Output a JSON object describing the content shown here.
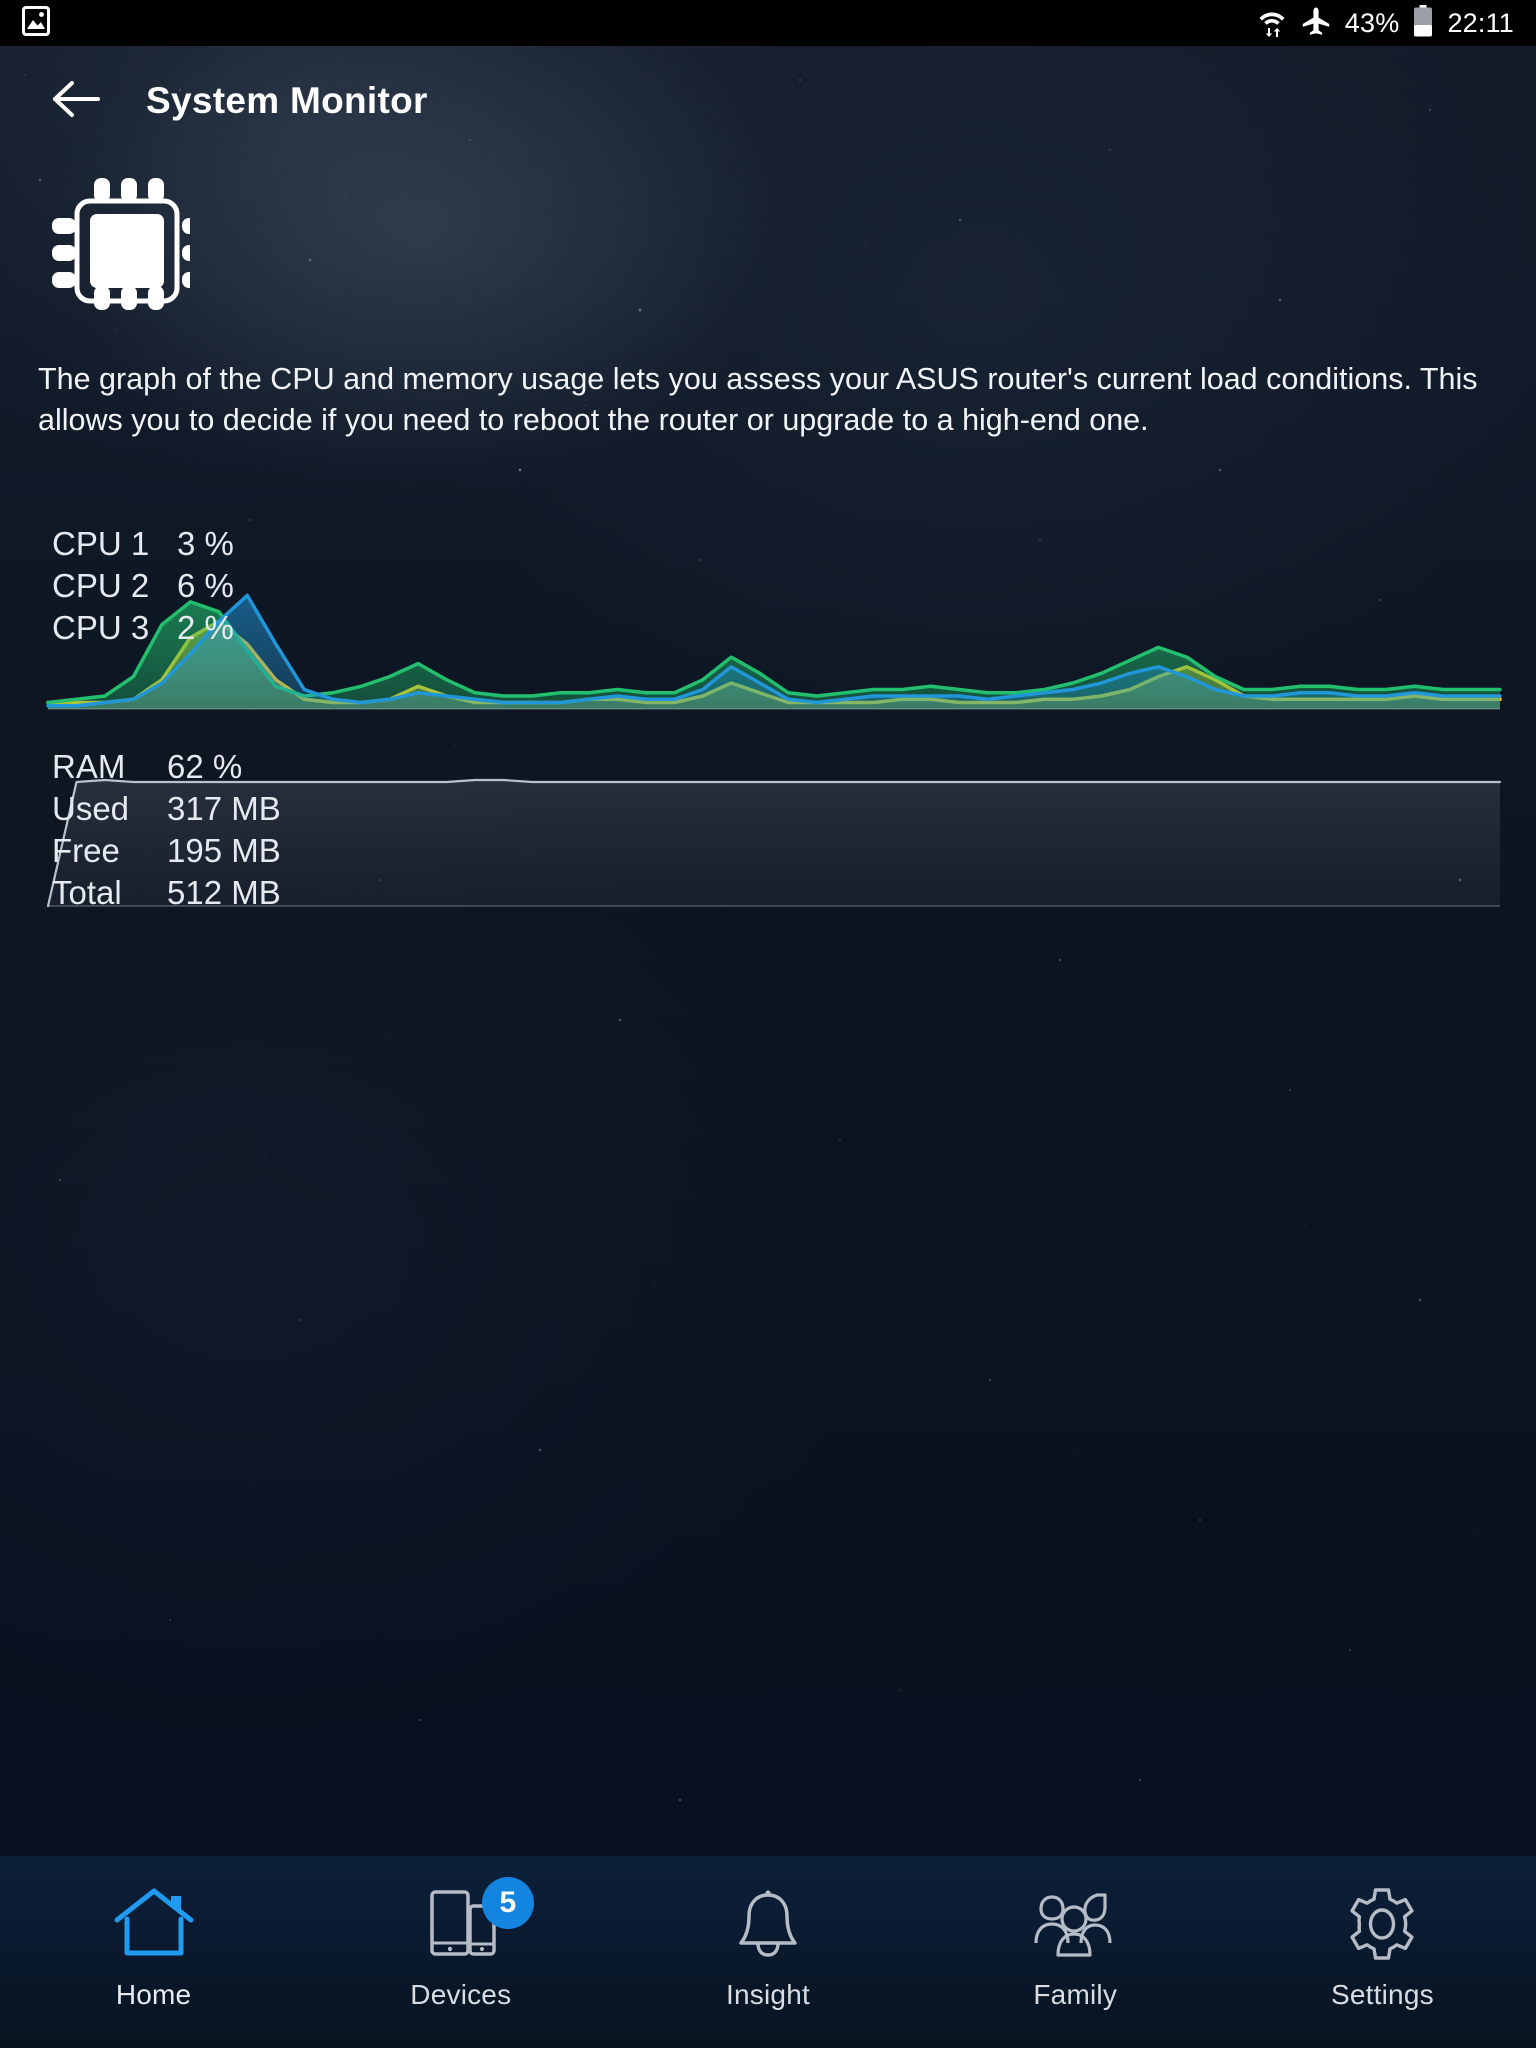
{
  "status_bar": {
    "left_icon": "image-icon",
    "wifi_icon": "wifi-transfer-icon",
    "airplane_icon": "airplane-mode-icon",
    "battery_percent": "43%",
    "battery_icon": "battery-icon",
    "time": "22:11"
  },
  "header": {
    "back_icon": "back-arrow-icon",
    "title": "System Monitor"
  },
  "main": {
    "hero_icon": "cpu-chip-icon",
    "description": "The graph of the CPU and memory usage lets you assess your ASUS router's current load conditions. This allows you to decide if you need to reboot the router or upgrade to a high-end one."
  },
  "cpu": {
    "rows": [
      {
        "label": "CPU 1",
        "value": "3 %",
        "color": "#f5c518"
      },
      {
        "label": "CPU 2",
        "value": "6 %",
        "color": "#22c06e"
      },
      {
        "label": "CPU 3",
        "value": "2 %",
        "color": "#2196d8"
      }
    ]
  },
  "ram": {
    "rows": [
      {
        "label": "RAM",
        "value": "62 %"
      },
      {
        "label": "Used",
        "value": "317 MB"
      },
      {
        "label": "Free",
        "value": "195 MB"
      },
      {
        "label": "Total",
        "value": "512 MB"
      }
    ]
  },
  "bottom_nav": {
    "items": [
      {
        "label": "Home",
        "icon": "home-icon",
        "active": true,
        "badge": null
      },
      {
        "label": "Devices",
        "icon": "devices-icon",
        "active": false,
        "badge": "5"
      },
      {
        "label": "Insight",
        "icon": "bell-icon",
        "active": false,
        "badge": null
      },
      {
        "label": "Family",
        "icon": "family-icon",
        "active": false,
        "badge": null
      },
      {
        "label": "Settings",
        "icon": "gear-icon",
        "active": false,
        "badge": null
      }
    ]
  },
  "colors": {
    "accent": "#1385e0",
    "cpu1": "#f5c518",
    "cpu2": "#22c06e",
    "cpu3": "#2196d8",
    "ram_line": "#b9c2cc",
    "background": "#0d1521",
    "text": "#ffffff"
  },
  "chart_data": [
    {
      "type": "area",
      "title": "CPU usage",
      "series": [
        {
          "name": "CPU 1",
          "color": "#f5c518",
          "values": [
            2,
            2,
            2,
            3,
            9,
            22,
            27,
            20,
            9,
            3,
            2,
            2,
            3,
            7,
            4,
            2,
            2,
            2,
            2,
            3,
            3,
            2,
            2,
            4,
            8,
            5,
            2,
            2,
            2,
            2,
            3,
            3,
            2,
            2,
            2,
            3,
            3,
            4,
            6,
            10,
            13,
            9,
            4,
            3,
            3,
            3,
            3,
            3,
            4,
            3,
            3,
            3
          ]
        },
        {
          "name": "CPU 2",
          "color": "#22c06e",
          "values": [
            2,
            3,
            4,
            10,
            26,
            33,
            30,
            18,
            7,
            4,
            5,
            7,
            10,
            14,
            9,
            5,
            4,
            4,
            5,
            5,
            6,
            5,
            5,
            9,
            16,
            11,
            5,
            4,
            5,
            6,
            6,
            7,
            6,
            5,
            5,
            6,
            8,
            11,
            15,
            19,
            16,
            10,
            6,
            6,
            7,
            7,
            6,
            6,
            7,
            6,
            6,
            6
          ]
        },
        {
          "name": "CPU 3",
          "color": "#2196d8",
          "values": [
            1,
            1,
            2,
            3,
            8,
            17,
            27,
            35,
            20,
            6,
            3,
            2,
            3,
            5,
            4,
            3,
            2,
            2,
            2,
            3,
            4,
            3,
            3,
            6,
            13,
            8,
            3,
            2,
            3,
            4,
            4,
            4,
            4,
            3,
            4,
            5,
            6,
            8,
            11,
            13,
            10,
            6,
            4,
            4,
            5,
            5,
            4,
            4,
            5,
            4,
            4,
            4
          ]
        }
      ],
      "ylim": [
        0,
        100
      ],
      "grid": false,
      "legend": "inline-top-left"
    },
    {
      "type": "area",
      "title": "RAM usage",
      "series": [
        {
          "name": "RAM",
          "color": "#b9c2cc",
          "values": [
            0,
            62,
            63,
            62,
            62,
            62,
            62,
            62,
            62,
            62,
            62,
            62,
            62,
            62,
            62,
            63,
            63,
            62,
            62,
            62,
            62,
            62,
            62,
            62,
            62,
            62,
            62,
            62,
            62,
            62,
            62,
            62,
            62,
            62,
            62,
            62,
            62,
            62,
            62,
            62,
            62,
            62,
            62,
            62,
            62,
            62,
            62,
            62,
            62,
            62,
            62,
            62
          ]
        }
      ],
      "ylim": [
        0,
        100
      ],
      "grid": false,
      "legend": "inline-top-left"
    }
  ]
}
